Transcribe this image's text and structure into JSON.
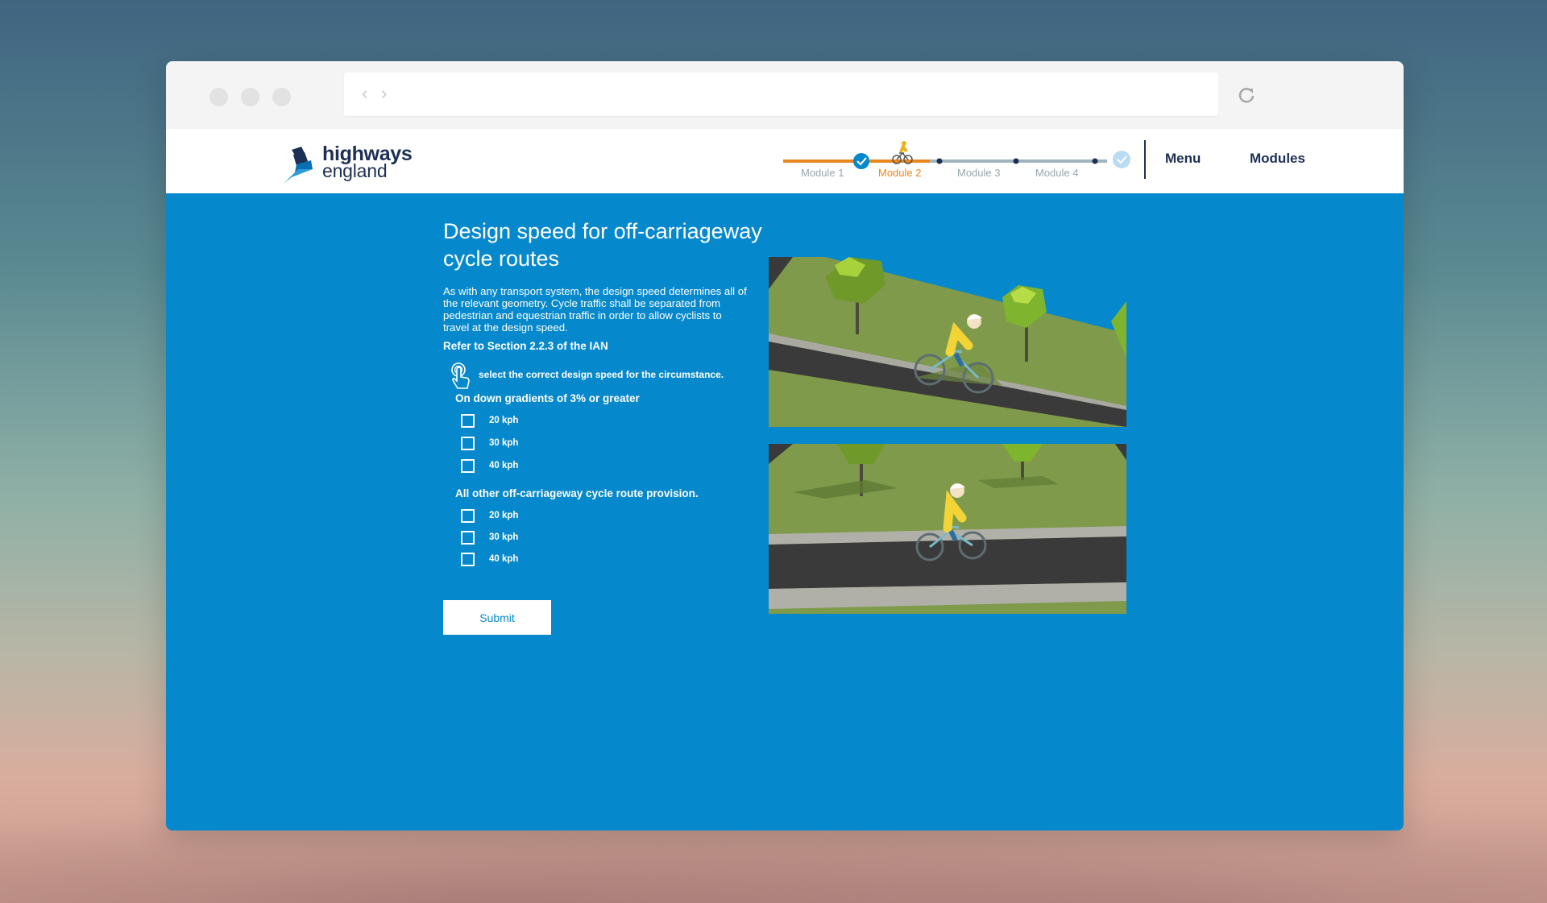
{
  "browser": {
    "url": ""
  },
  "header": {
    "logo": {
      "line1": "highways",
      "line2": "england"
    },
    "progress": {
      "modules": [
        {
          "label": "Module 1",
          "state": "completed"
        },
        {
          "label": "Module 2",
          "state": "current"
        },
        {
          "label": "Module 3",
          "state": "upcoming"
        },
        {
          "label": "Module 4",
          "state": "upcoming"
        }
      ]
    },
    "nav": {
      "menu": "Menu",
      "modules": "Modules"
    }
  },
  "main": {
    "title": "Design speed for off-carriageway cycle routes",
    "intro": "As with any transport system, the design speed determines all of the relevant geometry. Cycle traffic shall be separated from pedestrian and equestrian traffic in order to allow cyclists to travel at the design speed.",
    "reference": "Refer to Section 2.2.3 of the IAN",
    "instruction": "select the correct design speed for the circumstance.",
    "questions": [
      {
        "heading": "On down gradients of 3% or greater",
        "options": [
          "20 kph",
          "30 kph",
          "40 kph"
        ]
      },
      {
        "heading": "All other off-carriageway cycle route provision.",
        "options": [
          "20 kph",
          "30 kph",
          "40 kph"
        ]
      }
    ],
    "submit": "Submit"
  },
  "colors": {
    "page_blue": "#0689cc",
    "navy": "#1d2f55",
    "orange": "#e9861f",
    "grass": "#7f9a4a",
    "road": "#3a3a3a"
  }
}
